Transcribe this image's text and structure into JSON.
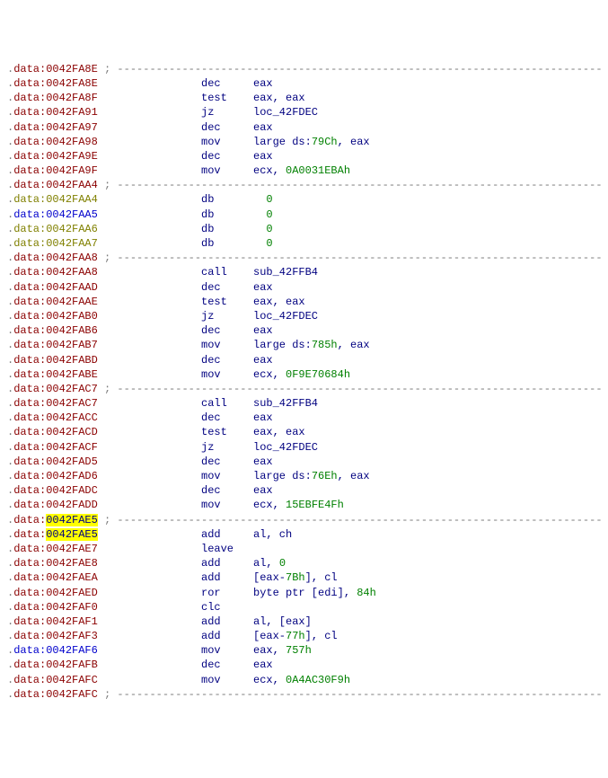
{
  "lines": [
    {
      "t": "dash",
      "seg": "red",
      "addr": "0042FA8E"
    },
    {
      "t": "instr",
      "seg": "red",
      "addr": "0042FA8E",
      "m": "dec",
      "o": [
        {
          "v": "eax"
        }
      ]
    },
    {
      "t": "instr",
      "seg": "red",
      "addr": "0042FA8F",
      "m": "test",
      "o": [
        {
          "v": "eax, eax"
        }
      ]
    },
    {
      "t": "instr",
      "seg": "red",
      "addr": "0042FA91",
      "m": "jz",
      "o": [
        {
          "v": "loc_42FDEC"
        }
      ]
    },
    {
      "t": "instr",
      "seg": "red",
      "addr": "0042FA97",
      "m": "dec",
      "o": [
        {
          "v": "eax"
        }
      ]
    },
    {
      "t": "instr",
      "seg": "red",
      "addr": "0042FA98",
      "m": "mov",
      "o": [
        {
          "v": "large ds:"
        },
        {
          "v": "79Ch",
          "g": true
        },
        {
          "v": ", eax"
        }
      ]
    },
    {
      "t": "instr",
      "seg": "red",
      "addr": "0042FA9E",
      "m": "dec",
      "o": [
        {
          "v": "eax"
        }
      ]
    },
    {
      "t": "instr",
      "seg": "red",
      "addr": "0042FA9F",
      "m": "mov",
      "o": [
        {
          "v": "ecx, "
        },
        {
          "v": "0A0031EBAh",
          "g": true
        }
      ]
    },
    {
      "t": "dash",
      "seg": "red",
      "addr": "0042FAA4"
    },
    {
      "t": "db",
      "seg": "olive",
      "addr": "0042FAA4",
      "val": "0"
    },
    {
      "t": "db",
      "seg": "blue",
      "addr": "0042FAA5",
      "val": "0"
    },
    {
      "t": "db",
      "seg": "olive",
      "addr": "0042FAA6",
      "val": "0"
    },
    {
      "t": "db",
      "seg": "olive",
      "addr": "0042FAA7",
      "val": "0"
    },
    {
      "t": "dash",
      "seg": "red",
      "addr": "0042FAA8"
    },
    {
      "t": "instr",
      "seg": "red",
      "addr": "0042FAA8",
      "m": "call",
      "o": [
        {
          "v": "sub_42FFB4"
        }
      ]
    },
    {
      "t": "instr",
      "seg": "red",
      "addr": "0042FAAD",
      "m": "dec",
      "o": [
        {
          "v": "eax"
        }
      ]
    },
    {
      "t": "instr",
      "seg": "red",
      "addr": "0042FAAE",
      "m": "test",
      "o": [
        {
          "v": "eax, eax"
        }
      ]
    },
    {
      "t": "instr",
      "seg": "red",
      "addr": "0042FAB0",
      "m": "jz",
      "o": [
        {
          "v": "loc_42FDEC"
        }
      ]
    },
    {
      "t": "instr",
      "seg": "red",
      "addr": "0042FAB6",
      "m": "dec",
      "o": [
        {
          "v": "eax"
        }
      ]
    },
    {
      "t": "instr",
      "seg": "red",
      "addr": "0042FAB7",
      "m": "mov",
      "o": [
        {
          "v": "large ds:"
        },
        {
          "v": "785h",
          "g": true
        },
        {
          "v": ", eax"
        }
      ]
    },
    {
      "t": "instr",
      "seg": "red",
      "addr": "0042FABD",
      "m": "dec",
      "o": [
        {
          "v": "eax"
        }
      ]
    },
    {
      "t": "instr",
      "seg": "red",
      "addr": "0042FABE",
      "m": "mov",
      "o": [
        {
          "v": "ecx, "
        },
        {
          "v": "0F9E70684h",
          "g": true
        }
      ]
    },
    {
      "t": "dash",
      "seg": "red",
      "addr": "0042FAC7"
    },
    {
      "t": "instr",
      "seg": "red",
      "addr": "0042FAC7",
      "m": "call",
      "o": [
        {
          "v": "sub_42FFB4"
        }
      ]
    },
    {
      "t": "instr",
      "seg": "red",
      "addr": "0042FACC",
      "m": "dec",
      "o": [
        {
          "v": "eax"
        }
      ]
    },
    {
      "t": "instr",
      "seg": "red",
      "addr": "0042FACD",
      "m": "test",
      "o": [
        {
          "v": "eax, eax"
        }
      ]
    },
    {
      "t": "instr",
      "seg": "red",
      "addr": "0042FACF",
      "m": "jz",
      "o": [
        {
          "v": "loc_42FDEC"
        }
      ]
    },
    {
      "t": "instr",
      "seg": "red",
      "addr": "0042FAD5",
      "m": "dec",
      "o": [
        {
          "v": "eax"
        }
      ]
    },
    {
      "t": "instr",
      "seg": "red",
      "addr": "0042FAD6",
      "m": "mov",
      "o": [
        {
          "v": "large ds:"
        },
        {
          "v": "76Eh",
          "g": true
        },
        {
          "v": ", eax"
        }
      ]
    },
    {
      "t": "instr",
      "seg": "red",
      "addr": "0042FADC",
      "m": "dec",
      "o": [
        {
          "v": "eax"
        }
      ]
    },
    {
      "t": "instr",
      "seg": "red",
      "addr": "0042FADD",
      "m": "mov",
      "o": [
        {
          "v": "ecx, "
        },
        {
          "v": "15EBFE4Fh",
          "g": true
        }
      ]
    },
    {
      "t": "dash",
      "seg": "red",
      "addr": "0042FAE5",
      "hl": true
    },
    {
      "t": "instr",
      "seg": "red",
      "addr": "0042FAE5",
      "hl": true,
      "m": "add",
      "o": [
        {
          "v": "al, ch"
        }
      ]
    },
    {
      "t": "instr",
      "seg": "red",
      "addr": "0042FAE7",
      "m": "leave",
      "o": []
    },
    {
      "t": "instr",
      "seg": "red",
      "addr": "0042FAE8",
      "m": "add",
      "o": [
        {
          "v": "al, "
        },
        {
          "v": "0",
          "g": true
        }
      ]
    },
    {
      "t": "instr",
      "seg": "red",
      "addr": "0042FAEA",
      "m": "add",
      "o": [
        {
          "v": "[eax-"
        },
        {
          "v": "7Bh",
          "g": true
        },
        {
          "v": "], cl"
        }
      ]
    },
    {
      "t": "instr",
      "seg": "red",
      "addr": "0042FAED",
      "m": "ror",
      "o": [
        {
          "v": "byte ptr [edi], "
        },
        {
          "v": "84h",
          "g": true
        }
      ]
    },
    {
      "t": "instr",
      "seg": "red",
      "addr": "0042FAF0",
      "m": "clc",
      "o": []
    },
    {
      "t": "instr",
      "seg": "red",
      "addr": "0042FAF1",
      "m": "add",
      "o": [
        {
          "v": "al, [eax]"
        }
      ]
    },
    {
      "t": "instr",
      "seg": "red",
      "addr": "0042FAF3",
      "m": "add",
      "o": [
        {
          "v": "[eax-"
        },
        {
          "v": "77h",
          "g": true
        },
        {
          "v": "], cl"
        }
      ]
    },
    {
      "t": "instr",
      "seg": "blue",
      "addr": "0042FAF6",
      "m": "mov",
      "o": [
        {
          "v": "eax, "
        },
        {
          "v": "757h",
          "g": true
        }
      ]
    },
    {
      "t": "instr",
      "seg": "red",
      "addr": "0042FAFB",
      "m": "dec",
      "o": [
        {
          "v": "eax"
        }
      ]
    },
    {
      "t": "instr",
      "seg": "red",
      "addr": "0042FAFC",
      "m": "mov",
      "o": [
        {
          "v": "ecx, "
        },
        {
          "v": "0A4AC30F9h",
          "g": true
        }
      ]
    },
    {
      "t": "dash",
      "seg": "red",
      "addr": "0042FAFC"
    }
  ],
  "labels": {
    "segPrefix": ".data:",
    "dbMnemonic": "db",
    "dashTail": " ; ---------------------------------------------------------------------------"
  }
}
